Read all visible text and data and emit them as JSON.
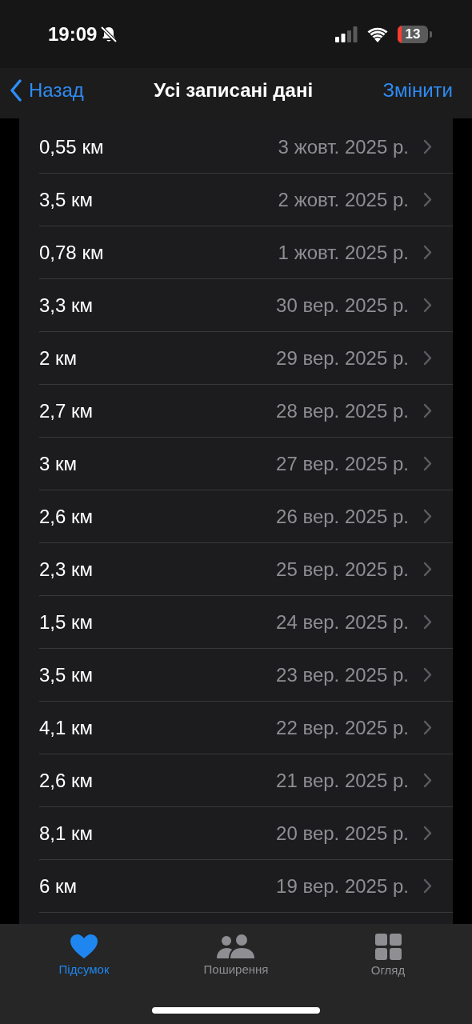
{
  "status_bar": {
    "time": "19:09",
    "battery": "13"
  },
  "nav": {
    "back": "Назад",
    "title": "Усі записані дані",
    "action": "Змінити"
  },
  "records": [
    {
      "value": "0,55 км",
      "date": "3 жовт. 2025 р."
    },
    {
      "value": "3,5 км",
      "date": "2 жовт. 2025 р."
    },
    {
      "value": "0,78 км",
      "date": "1 жовт. 2025 р."
    },
    {
      "value": "3,3 км",
      "date": "30 вер. 2025 р."
    },
    {
      "value": "2 км",
      "date": "29 вер. 2025 р."
    },
    {
      "value": "2,7 км",
      "date": "28 вер. 2025 р."
    },
    {
      "value": "3 км",
      "date": "27 вер. 2025 р."
    },
    {
      "value": "2,6 км",
      "date": "26 вер. 2025 р."
    },
    {
      "value": "2,3 км",
      "date": "25 вер. 2025 р."
    },
    {
      "value": "1,5 км",
      "date": "24 вер. 2025 р."
    },
    {
      "value": "3,5 км",
      "date": "23 вер. 2025 р."
    },
    {
      "value": "4,1 км",
      "date": "22 вер. 2025 р."
    },
    {
      "value": "2,6 км",
      "date": "21 вер. 2025 р."
    },
    {
      "value": "8,1 км",
      "date": "20 вер. 2025 р."
    },
    {
      "value": "6 км",
      "date": "19 вер. 2025 р."
    }
  ],
  "tabs": [
    {
      "kind": "heart",
      "label": "Підсумок",
      "selected": true
    },
    {
      "kind": "people",
      "label": "Поширення",
      "selected": false
    },
    {
      "kind": "grid",
      "label": "Огляд",
      "selected": false
    }
  ]
}
